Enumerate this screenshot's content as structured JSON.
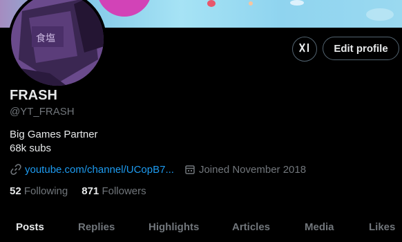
{
  "profile": {
    "name": "FRASH",
    "handle": "@YT_FRASH",
    "bio_line1": "Big Games Partner",
    "bio_line2": "68k subs",
    "link": "youtube.com/channel/UCopB7...",
    "joined": "Joined November 2018",
    "following_count": "52",
    "following_label": "Following",
    "followers_count": "871",
    "followers_label": "Followers"
  },
  "actions": {
    "x_label": "X",
    "edit_label": "Edit profile"
  },
  "avatar": {
    "sign_text": "食塩"
  },
  "tabs": [
    {
      "label": "Posts",
      "active": true
    },
    {
      "label": "Replies"
    },
    {
      "label": "Highlights"
    },
    {
      "label": "Articles"
    },
    {
      "label": "Media"
    },
    {
      "label": "Likes"
    }
  ],
  "colors": {
    "background": "#000000",
    "text": "#e7e9ea",
    "muted": "#71767b",
    "link": "#1d9bf0",
    "border": "#536471"
  }
}
